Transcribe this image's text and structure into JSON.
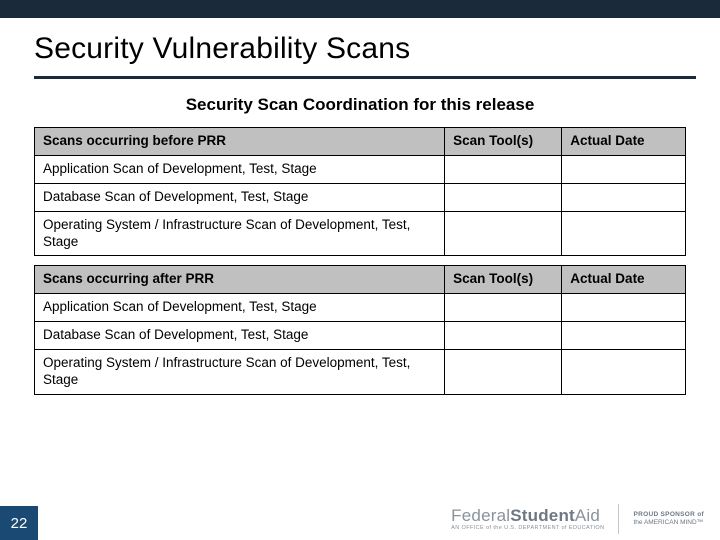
{
  "header": {
    "title": "Security Vulnerability Scans",
    "subtitle": "Security Scan Coordination for this release"
  },
  "table": {
    "sections": [
      {
        "header": {
          "desc": "Scans occurring before PRR",
          "tool": "Scan Tool(s)",
          "date": "Actual Date"
        },
        "rows": [
          {
            "desc": "Application Scan of Development, Test, Stage",
            "tool": "",
            "date": ""
          },
          {
            "desc": "Database Scan of Development, Test, Stage",
            "tool": "",
            "date": ""
          },
          {
            "desc": "Operating System / Infrastructure Scan of Development, Test, Stage",
            "tool": "",
            "date": ""
          }
        ]
      },
      {
        "header": {
          "desc": "Scans occurring after PRR",
          "tool": "Scan Tool(s)",
          "date": "Actual Date"
        },
        "rows": [
          {
            "desc": "Application Scan of Development, Test, Stage",
            "tool": "",
            "date": ""
          },
          {
            "desc": "Database Scan of Development, Test, Stage",
            "tool": "",
            "date": ""
          },
          {
            "desc": "Operating System / Infrastructure Scan of Development, Test, Stage",
            "tool": "",
            "date": ""
          }
        ]
      }
    ]
  },
  "footer": {
    "page_number": "22",
    "logo": {
      "word1": "Federal",
      "word2": "Student",
      "word3": "Aid",
      "sub": "AN OFFICE of the U.S. DEPARTMENT of EDUCATION"
    },
    "sponsor": {
      "line1": "PROUD SPONSOR of",
      "line2": "the AMERICAN MIND™"
    }
  }
}
